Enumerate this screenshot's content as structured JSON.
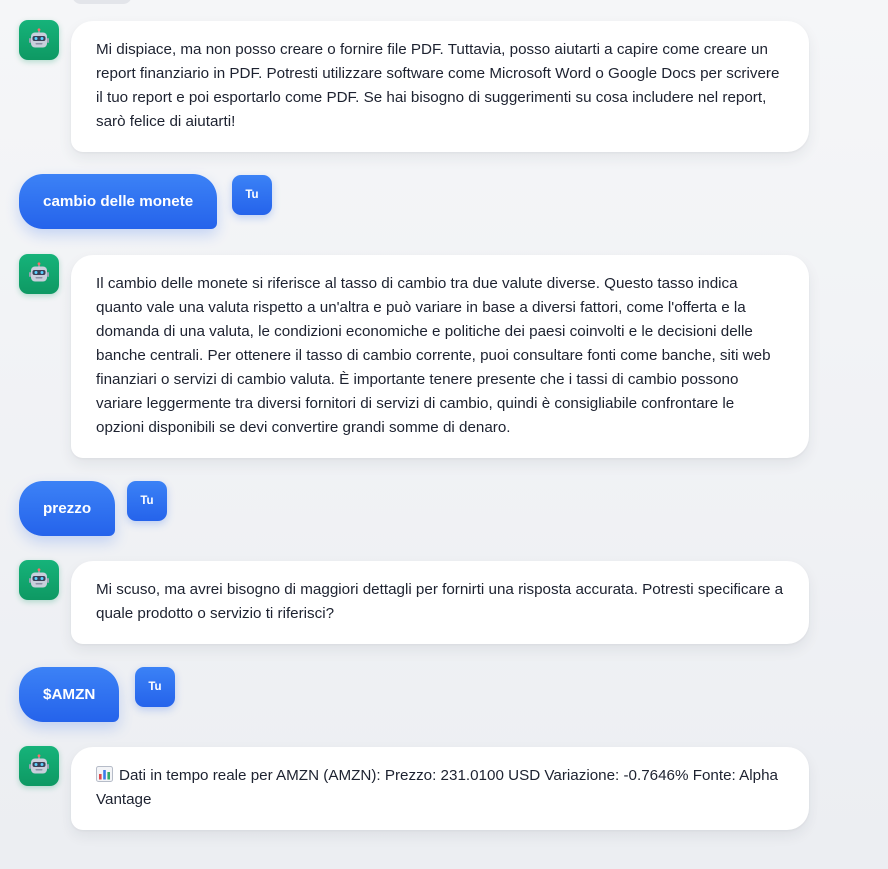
{
  "messages": [
    {
      "role": "bot",
      "text": "Mi dispiace, ma non posso creare o fornire file PDF. Tuttavia, posso aiutarti a capire come creare un report finanziario in PDF. Potresti utilizzare software come Microsoft Word o Google Docs per scrivere il tuo report e poi esportarlo come PDF. Se hai bisogno di suggerimenti su cosa includere nel report, sarò felice di aiutarti!"
    },
    {
      "role": "user",
      "text": "cambio delle monete",
      "avatar_label": "Tu"
    },
    {
      "role": "bot",
      "text": "Il cambio delle monete si riferisce al tasso di cambio tra due valute diverse. Questo tasso indica quanto vale una valuta rispetto a un'altra e può variare in base a diversi fattori, come l'offerta e la domanda di una valuta, le condizioni economiche e politiche dei paesi coinvolti e le decisioni delle banche centrali. Per ottenere il tasso di cambio corrente, puoi consultare fonti come banche, siti web finanziari o servizi di cambio valuta. È importante tenere presente che i tassi di cambio possono variare leggermente tra diversi fornitori di servizi di cambio, quindi è consigliabile confrontare le opzioni disponibili se devi convertire grandi somme di denaro."
    },
    {
      "role": "user",
      "text": "prezzo",
      "avatar_label": "Tu"
    },
    {
      "role": "bot",
      "text": "Mi scuso, ma avrei bisogno di maggiori dettagli per fornirti una risposta accurata. Potresti specificare a quale prodotto o servizio ti riferisci?"
    },
    {
      "role": "user",
      "text": "$AMZN",
      "avatar_label": "Tu"
    },
    {
      "role": "bot",
      "icon": "bar-chart-icon",
      "text": "Dati in tempo reale per AMZN (AMZN): Prezzo: 231.0100 USD Variazione: -0.7646% Fonte: Alpha Vantage"
    }
  ],
  "colors": {
    "bot_avatar": "#10a66f",
    "user_bubble": "#2f6ff0",
    "bot_bubble": "#ffffff",
    "text": "#1d2230",
    "background": "#f1f2f5"
  }
}
